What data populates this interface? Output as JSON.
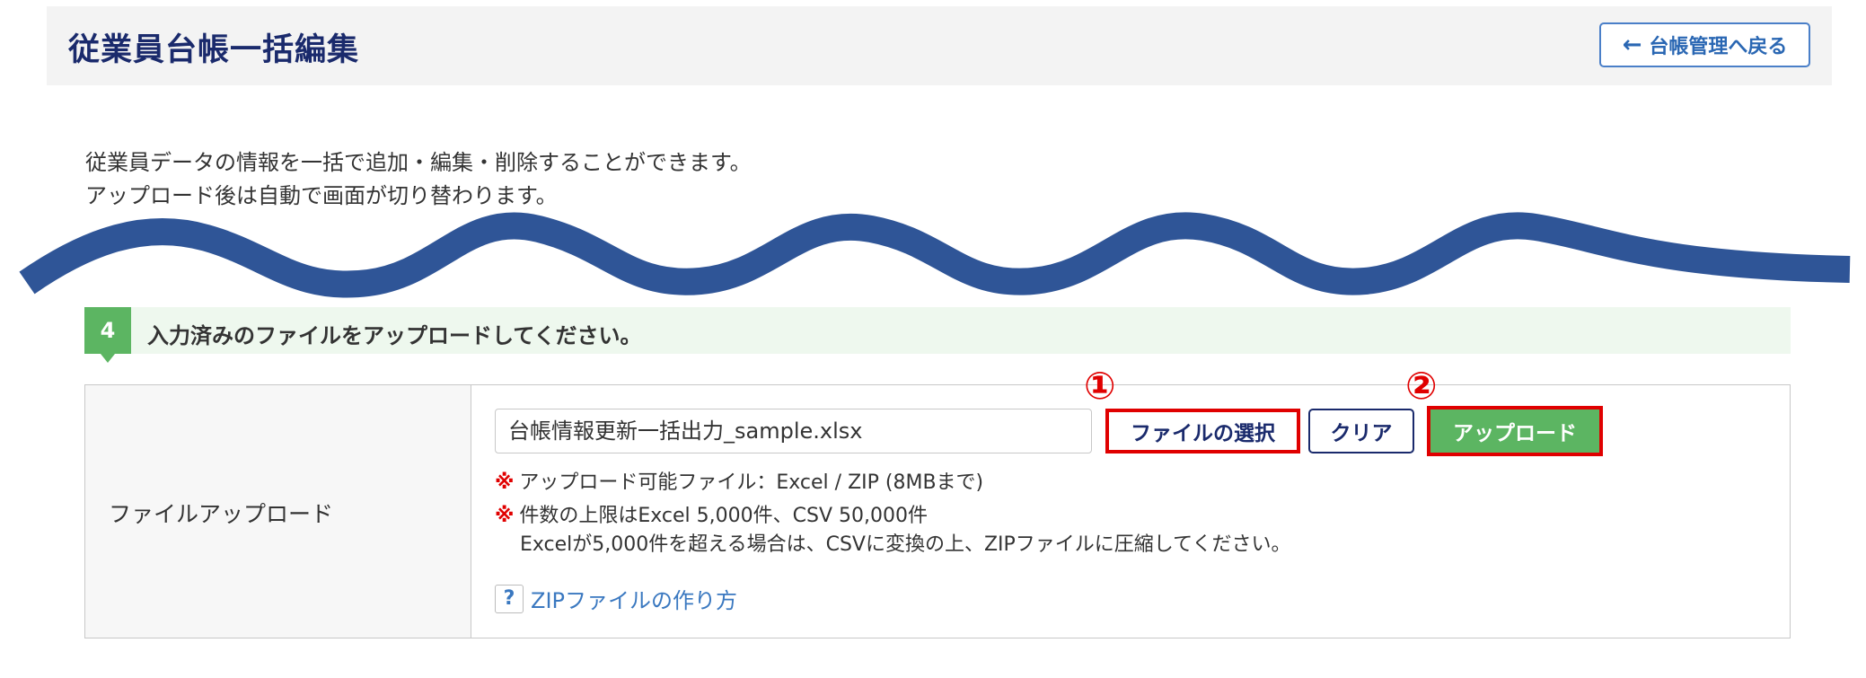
{
  "header": {
    "title": "従業員台帳一括編集",
    "back_label": "台帳管理へ戻る"
  },
  "intro": {
    "line1": "従業員データの情報を一括で追加・編集・削除することができます。",
    "line2": "アップロード後は自動で画面が切り替わります。"
  },
  "step": {
    "number": "4",
    "text": "入力済みのファイルをアップロードしてください。"
  },
  "upload": {
    "label": "ファイルアップロード",
    "file_value": "台帳情報更新一括出力_sample.xlsx",
    "select_button": "ファイルの選択",
    "clear_button": "クリア",
    "upload_button": "アップロード",
    "marker1": "①",
    "marker2": "②",
    "note_mark": "※",
    "note1": "アップロード可能ファイル：Excel / ZIP (8MBまで)",
    "note2": "件数の上限はExcel 5,000件、CSV 50,000件",
    "note3": "Excelが5,000件を超える場合は、CSVに変換の上、ZIPファイルに圧縮してください。",
    "help_icon": "?",
    "help_link": "ZIPファイルの作り方"
  },
  "colors": {
    "accent_green": "#5cb562",
    "highlight_red": "#e00000",
    "navy": "#1a2a6c",
    "link_blue": "#3a78c0",
    "wave_blue": "#2f5597"
  }
}
